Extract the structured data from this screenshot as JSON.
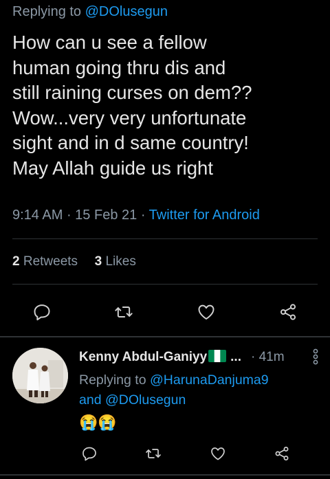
{
  "tweet": {
    "replying_prefix": "Replying to",
    "replying_handle": "@DOlusegun",
    "text": "How can u see a fellow\nhuman going thru dis and\nstill raining curses on dem??\nWow...very very unfortunate\nsight and in d same country!\nMay Allah guide us right",
    "time": "9:14 AM",
    "date": "15 Feb 21",
    "source": "Twitter for Android",
    "retweets_count": "2",
    "retweets_label": "Retweets",
    "likes_count": "3",
    "likes_label": "Likes"
  },
  "reply": {
    "name": "Kenny Abdul-Ganiyy",
    "ellipsis": "...",
    "time": "· 41m",
    "replying_prefix": "Replying to",
    "handle1": "@HarunaDanjuma9",
    "and": "and",
    "handle2": "@DOlusegun",
    "emoji_text": "😭😭"
  },
  "colors": {
    "background": "#000000",
    "link": "#1d9bf0",
    "muted": "#8b98a5",
    "text": "#e6e6e6"
  },
  "icons": [
    "reply-icon",
    "retweet-icon",
    "like-icon",
    "share-icon",
    "more-icon",
    "nigeria-flag-icon"
  ]
}
